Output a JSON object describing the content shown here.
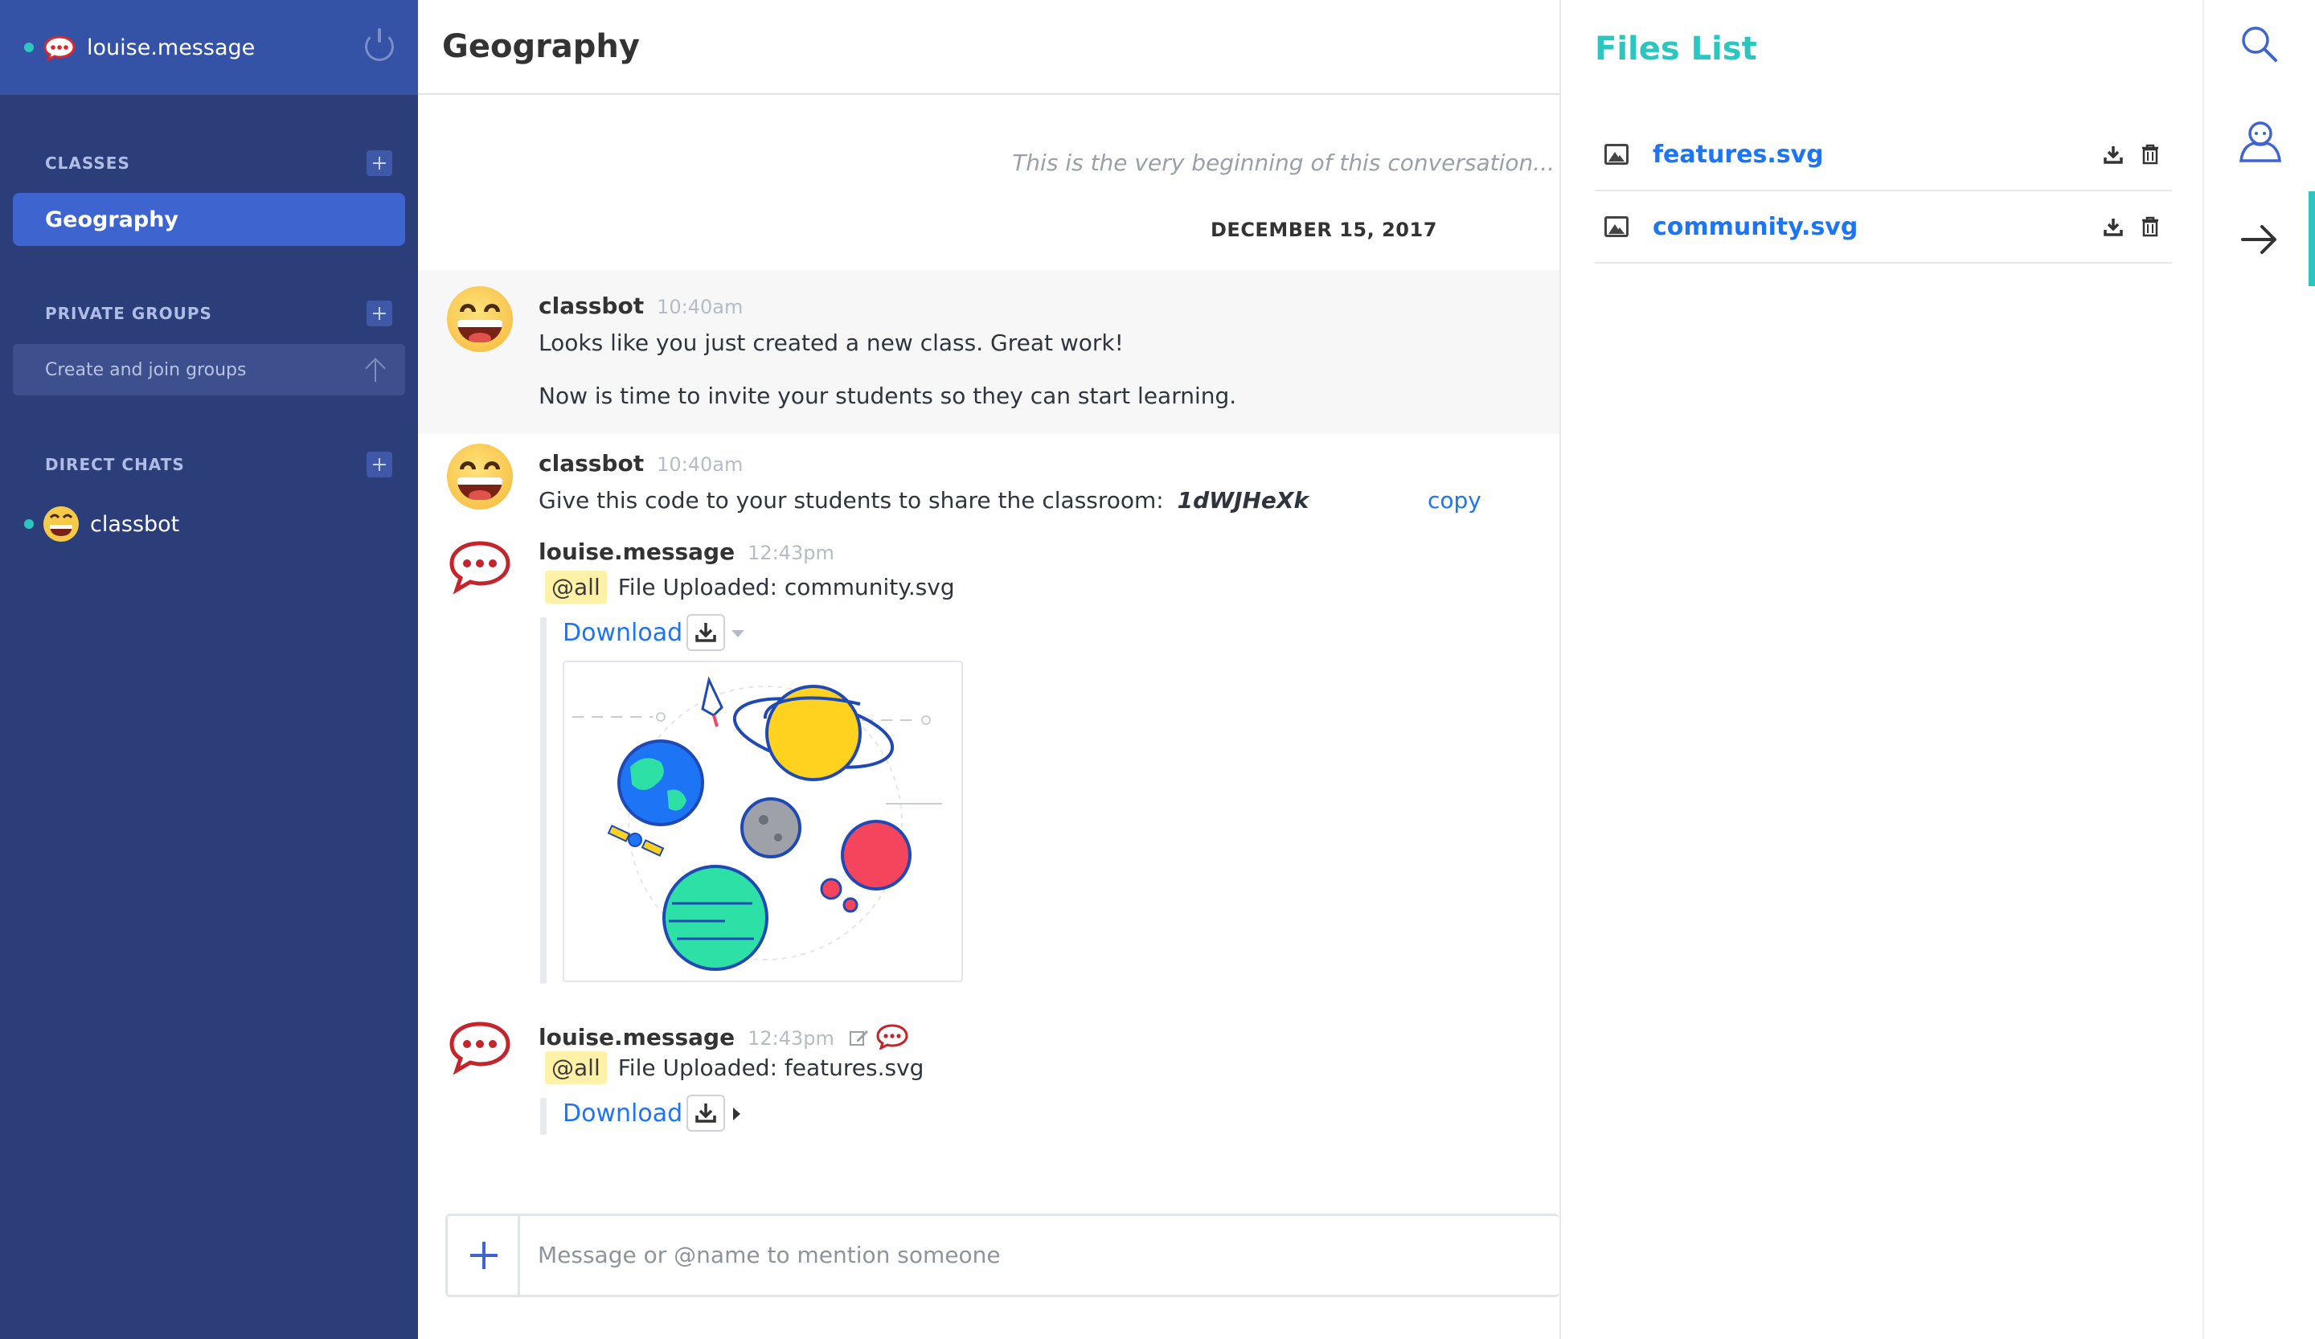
{
  "sidebar": {
    "username": "louise.message",
    "sections": {
      "classes": "CLASSES",
      "private_groups": "PRIVATE GROUPS",
      "direct_chats": "DIRECT CHATS"
    },
    "active_class": "Geography",
    "create_groups_label": "Create and join groups",
    "direct_chat_user": "classbot"
  },
  "room": {
    "title": "Geography",
    "beginning_text": "This is the very beginning of this conversation...",
    "date_divider": "DECEMBER 15, 2017"
  },
  "messages": [
    {
      "author": "classbot",
      "time": "10:40am",
      "lines": [
        "Looks like you just created a new class. Great work!",
        "Now is time to invite your students so they can start learning."
      ]
    },
    {
      "author": "classbot",
      "time": "10:40am",
      "text": "Give this code to your students to share the classroom:",
      "code": "1dWJHeXk",
      "copy_label": "copy"
    },
    {
      "author": "louise.message",
      "time": "12:43pm",
      "mention": "@all",
      "text": "File Uploaded: community.svg",
      "download_label": "Download"
    },
    {
      "author": "louise.message",
      "time": "12:43pm",
      "mention": "@all",
      "text": "File Uploaded: features.svg",
      "download_label": "Download"
    }
  ],
  "composer": {
    "placeholder": "Message or @name to mention someone"
  },
  "files_panel": {
    "title": "Files List",
    "files": [
      {
        "name": "features.svg",
        "icon": "image-icon"
      },
      {
        "name": "community.svg",
        "icon": "image-icon"
      }
    ]
  },
  "toolbar": {
    "icons": [
      "search-icon",
      "user-icon",
      "arrow-right-icon"
    ]
  },
  "colors": {
    "sidebar_bg": "#2c3e7a",
    "sidebar_header": "#3452a6",
    "active_item": "#3e64d0",
    "accent_teal": "#2bc6c0",
    "link_blue": "#1d74f5",
    "mention_bg": "#fff2a8"
  }
}
